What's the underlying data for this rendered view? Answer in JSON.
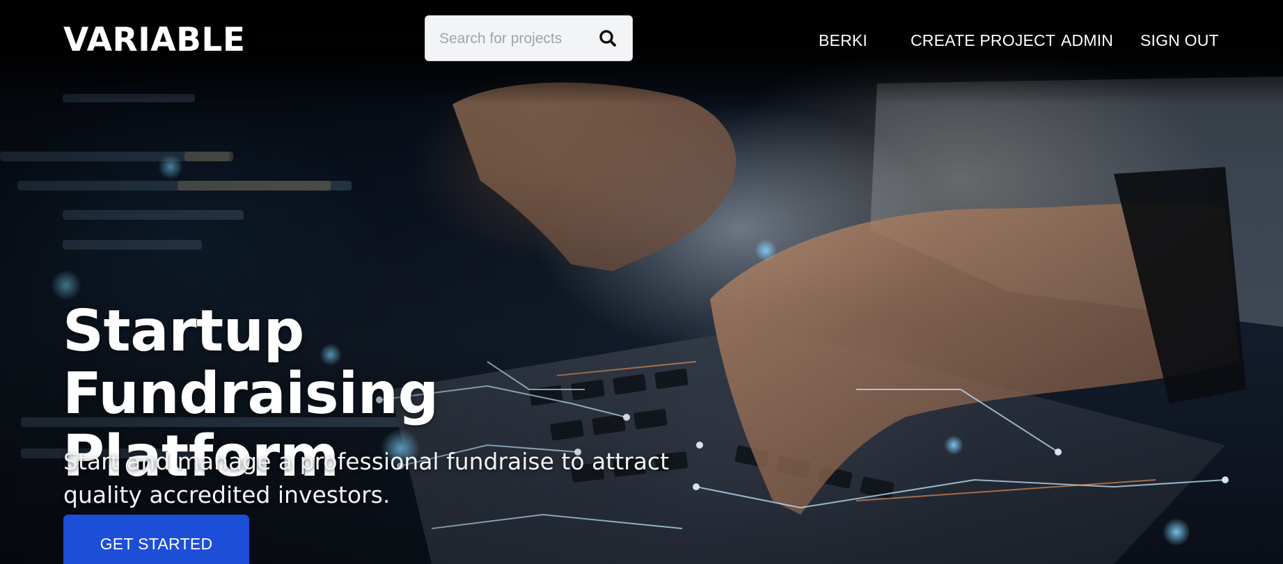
{
  "header": {
    "logo": "VARIABLE",
    "search": {
      "placeholder": "Search for projects",
      "value": "",
      "icon": "search-icon"
    },
    "nav": {
      "user": "BERKI",
      "create_project": "CREATE PROJECT",
      "admin": "ADMIN",
      "sign_out": "SIGN OUT"
    }
  },
  "hero": {
    "title": "Startup Fundraising Platform",
    "subtitle": "Start and manage a professional fundraise to attract quality accredited investors.",
    "cta_label": "GET STARTED",
    "background_image": "hands typing on laptop keyboard with code overlay"
  },
  "colors": {
    "accent": "#1d4ed8",
    "nav_background": "#000000",
    "text": "#ffffff"
  }
}
